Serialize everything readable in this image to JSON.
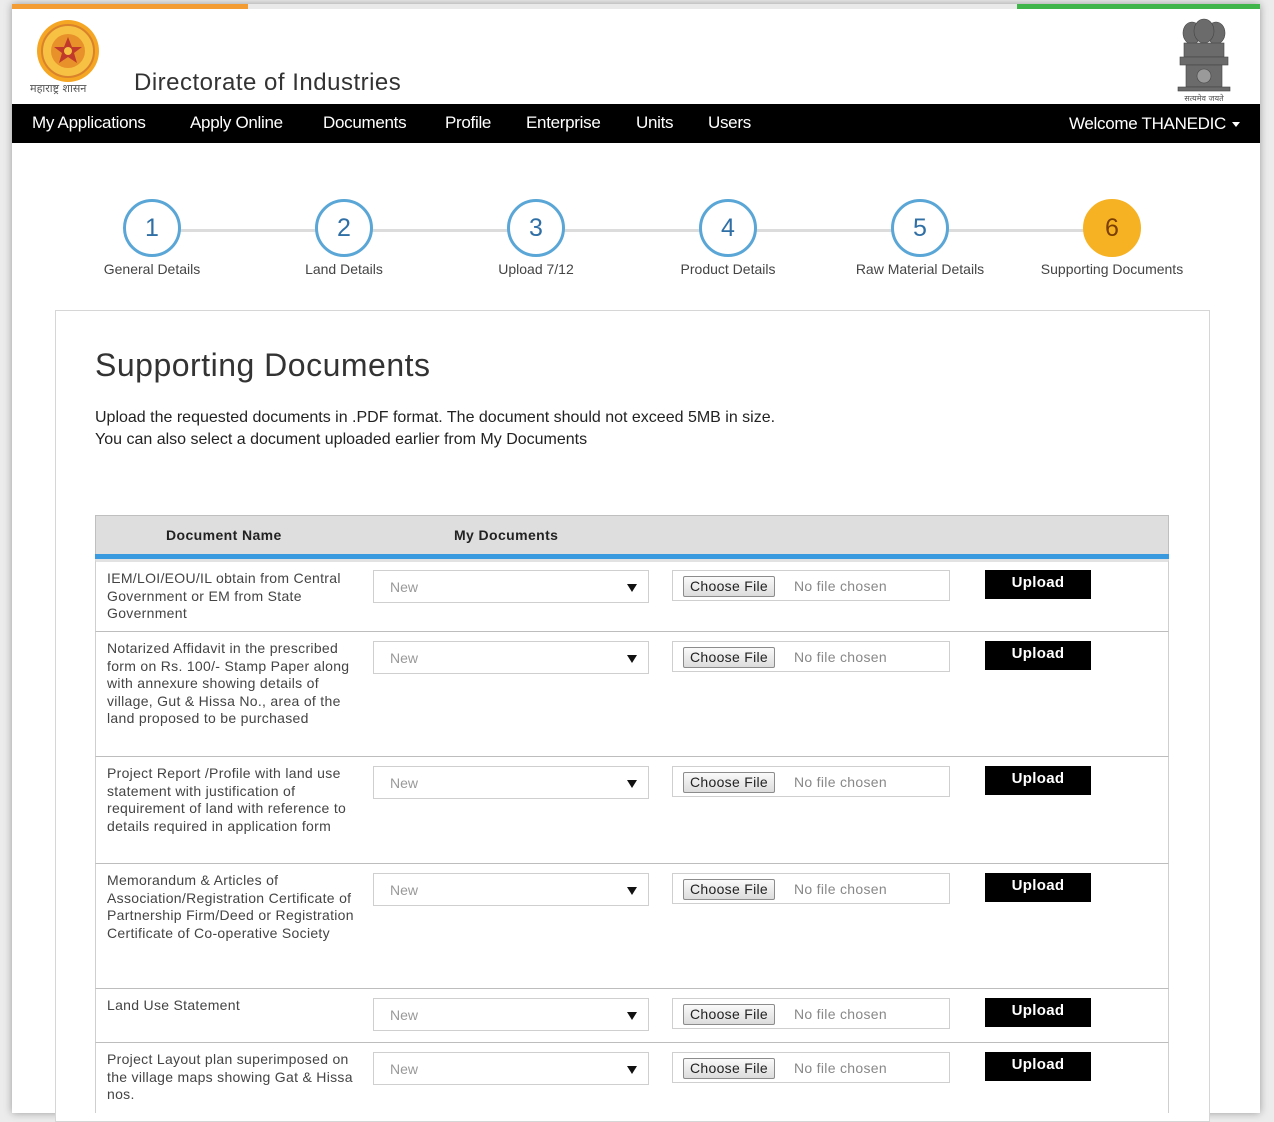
{
  "brand": {
    "colors": {
      "saffron": "#f39c34",
      "green": "#3fb54a",
      "nav_bg": "#000000",
      "step_active": "#f6b223",
      "step_border": "#5aa6d6",
      "table_rule": "#3a9ae0"
    },
    "logo_caption": "महाराष्ट्र शासन",
    "site_title": "Directorate of Industries",
    "emblem_caption": "सत्यमेव जयते"
  },
  "nav": {
    "items": [
      {
        "label": "My Applications"
      },
      {
        "label": "Apply Online"
      },
      {
        "label": "Documents"
      },
      {
        "label": "Profile"
      },
      {
        "label": "Enterprise"
      },
      {
        "label": "Units"
      },
      {
        "label": "Users"
      }
    ],
    "welcome": "Welcome THANEDIC"
  },
  "steps": [
    {
      "number": "1",
      "label": "General Details",
      "active": false
    },
    {
      "number": "2",
      "label": "Land Details",
      "active": false
    },
    {
      "number": "3",
      "label": "Upload 7/12",
      "active": false
    },
    {
      "number": "4",
      "label": "Product Details",
      "active": false
    },
    {
      "number": "5",
      "label": "Raw Material Details",
      "active": false
    },
    {
      "number": "6",
      "label": "Supporting Documents",
      "active": true
    }
  ],
  "page": {
    "title": "Supporting Documents",
    "intro_line1": "Upload the requested documents in .PDF format. The document should not exceed 5MB in size.",
    "intro_line2": "You can also select a document uploaded earlier from My Documents"
  },
  "table": {
    "headers": {
      "document_name": "Document Name",
      "my_documents": "My Documents"
    },
    "rows": [
      {
        "name": "IEM/LOI/EOU/IL obtain from Central Government or EM from State Government",
        "select_value": "New",
        "choose_label": "Choose File",
        "file_status": "No file chosen",
        "upload_label": "Upload"
      },
      {
        "name": "Notarized Affidavit in the prescribed form on Rs. 100/- Stamp Paper along with annexure showing details of village, Gut & Hissa No., area of the land proposed to be purchased",
        "select_value": "New",
        "choose_label": "Choose File",
        "file_status": "No file chosen",
        "upload_label": "Upload"
      },
      {
        "name": "Project Report /Profile with land use statement with justification of requirement of land with reference to details required in application form",
        "select_value": "New",
        "choose_label": "Choose File",
        "file_status": "No file chosen",
        "upload_label": "Upload"
      },
      {
        "name": "Memorandum & Articles of Association/Registration Certificate of Partnership Firm/Deed or Registration Certificate of Co-operative Society",
        "select_value": "New",
        "choose_label": "Choose File",
        "file_status": "No file chosen",
        "upload_label": "Upload"
      },
      {
        "name": "Land Use Statement",
        "select_value": "New",
        "choose_label": "Choose File",
        "file_status": "No file chosen",
        "upload_label": "Upload"
      },
      {
        "name": "Project Layout plan superimposed on the village maps showing Gat & Hissa nos.",
        "select_value": "New",
        "choose_label": "Choose File",
        "file_status": "No file chosen",
        "upload_label": "Upload"
      }
    ]
  }
}
